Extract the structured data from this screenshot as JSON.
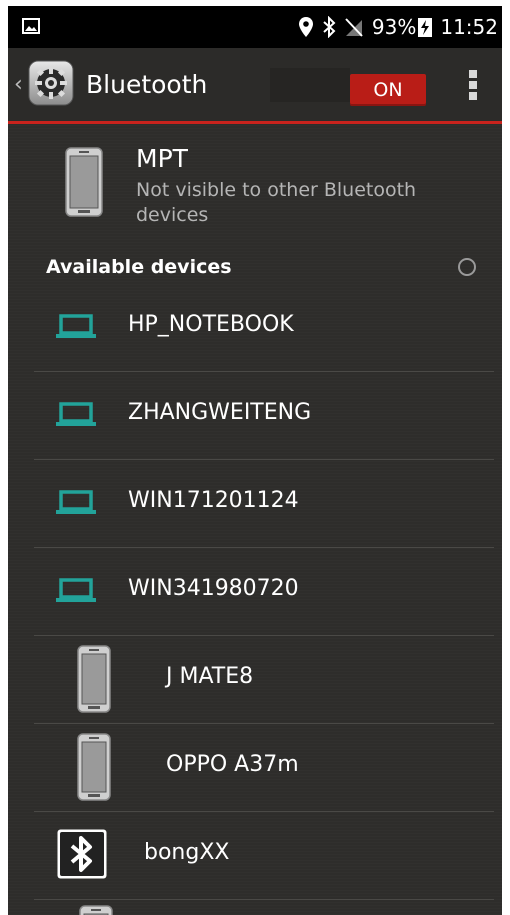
{
  "status_bar": {
    "battery_percent": "93%",
    "time": "11:52"
  },
  "action_bar": {
    "title": "Bluetooth",
    "toggle_label": "ON"
  },
  "own_device": {
    "name": "MPT",
    "visibility_status": "Not visible to other Bluetooth devices"
  },
  "available_section": {
    "header": "Available devices"
  },
  "devices": [
    {
      "name": "HP_NOTEBOOK",
      "icon": "laptop-icon"
    },
    {
      "name": "ZHANGWEITENG",
      "icon": "laptop-icon"
    },
    {
      "name": "WIN171201124",
      "icon": "laptop-icon"
    },
    {
      "name": "WIN341980720",
      "icon": "laptop-icon"
    },
    {
      "name": "J MATE8",
      "icon": "phone-icon"
    },
    {
      "name": "OPPO A37m",
      "icon": "phone-icon"
    },
    {
      "name": "bongXX",
      "icon": "bluetooth-icon"
    }
  ],
  "colors": {
    "accent_red": "#c9231d",
    "toggle_red": "#b91d17",
    "laptop_teal": "#22a39a",
    "background": "#2e2d2b"
  }
}
